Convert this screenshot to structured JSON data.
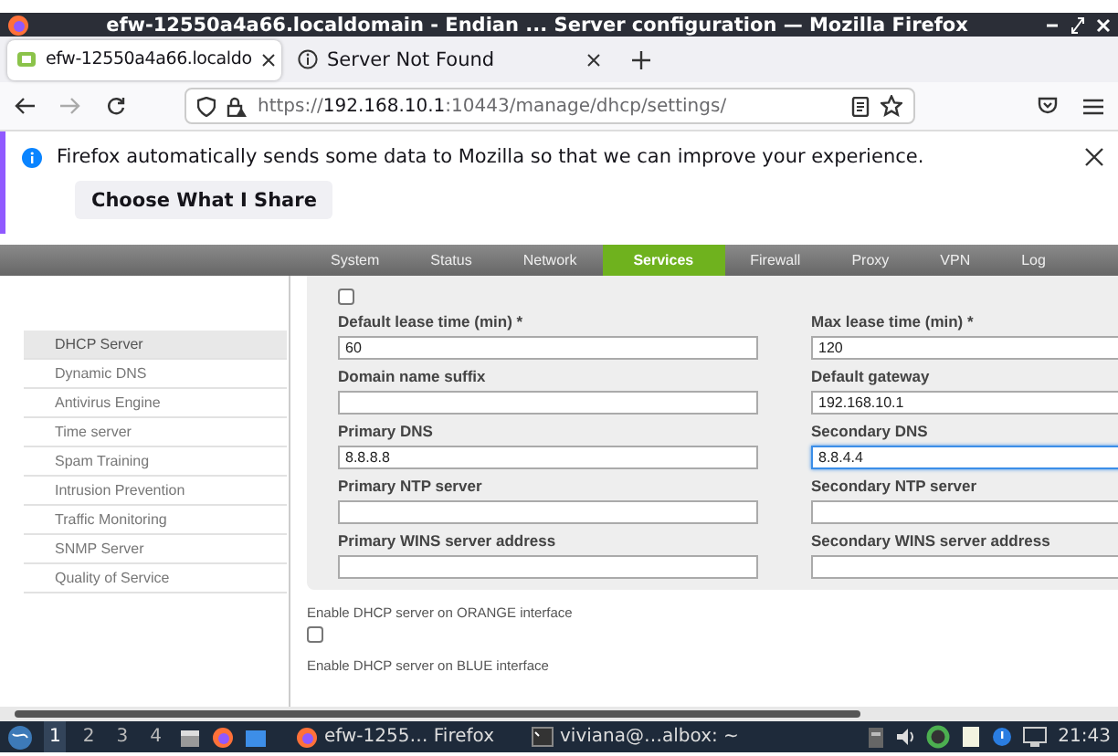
{
  "window": {
    "title": "efw-12550a4a66.localdomain - Endian ... Server configuration — Mozilla Firefox"
  },
  "tabs": [
    {
      "label": "efw-12550a4a66.localdo",
      "selected": true
    },
    {
      "label": "Server Not Found",
      "selected": false
    }
  ],
  "address_bar": {
    "scheme": "https://",
    "host": "192.168.10.1",
    "path": ":10443/manage/dhcp/settings/"
  },
  "notification": {
    "message": "Firefox automatically sends some data to Mozilla so that we can improve your experience.",
    "button": "Choose What I Share"
  },
  "main_nav": [
    {
      "label": "System",
      "selected": false
    },
    {
      "label": "Status",
      "selected": false
    },
    {
      "label": "Network",
      "selected": false
    },
    {
      "label": "Services",
      "selected": true
    },
    {
      "label": "Firewall",
      "selected": false
    },
    {
      "label": "Proxy",
      "selected": false
    },
    {
      "label": "VPN",
      "selected": false
    },
    {
      "label": "Log",
      "selected": false
    }
  ],
  "sidebar": {
    "items": [
      {
        "label": "DHCP Server",
        "selected": true
      },
      {
        "label": "Dynamic DNS",
        "selected": false
      },
      {
        "label": "Antivirus Engine",
        "selected": false
      },
      {
        "label": "Time server",
        "selected": false
      },
      {
        "label": "Spam Training",
        "selected": false
      },
      {
        "label": "Intrusion Prevention",
        "selected": false
      },
      {
        "label": "Traffic Monitoring",
        "selected": false
      },
      {
        "label": "SNMP Server",
        "selected": false
      },
      {
        "label": "Quality of Service",
        "selected": false
      }
    ]
  },
  "form": {
    "top_checkbox": {
      "checked": false
    },
    "fields": [
      {
        "label": "Default lease time (min) *",
        "value": "60",
        "focused": false
      },
      {
        "label": "Max lease time (min) *",
        "value": "120",
        "focused": false
      },
      {
        "label": "Domain name suffix",
        "focused": false
      },
      {
        "label": "Default gateway",
        "value": "192.168.10.1",
        "focused": false
      },
      {
        "label": "Primary DNS",
        "value": "8.8.8.8",
        "focused": false
      },
      {
        "label": "Secondary DNS",
        "value": "8.8.4.4",
        "focused": true
      },
      {
        "label": "Primary NTP server",
        "focused": false
      },
      {
        "label": "Secondary NTP server",
        "focused": false
      },
      {
        "label": "Primary WINS server address",
        "focused": false
      },
      {
        "label": "Secondary WINS server address",
        "focused": false
      }
    ]
  },
  "interfaces": [
    {
      "label": "Enable DHCP server on ORANGE interface",
      "checked": false
    },
    {
      "label": "Enable DHCP server on BLUE interface"
    }
  ],
  "taskbar": {
    "workspaces": [
      {
        "label": "1",
        "selected": true
      },
      {
        "label": "2",
        "selected": false
      },
      {
        "label": "3",
        "selected": false
      },
      {
        "label": "4",
        "selected": false
      }
    ],
    "windows": [
      {
        "kind": "browser",
        "label": "efw-1255… Firefox"
      },
      {
        "kind": "terminal",
        "label": "viviana@…albox: ~"
      }
    ],
    "clock": "21:43"
  }
}
